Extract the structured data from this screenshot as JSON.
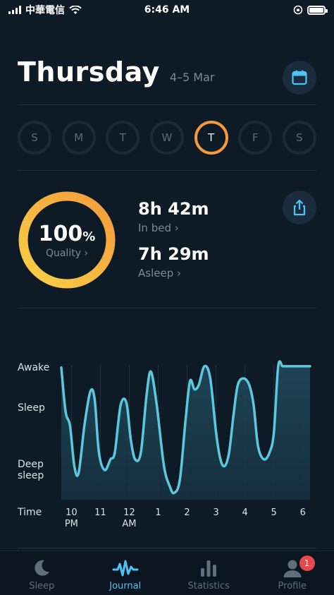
{
  "status_bar": {
    "carrier": "中華電信",
    "time": "6:46 AM"
  },
  "header": {
    "day": "Thursday",
    "date_range": "4–5 Mar"
  },
  "week": [
    {
      "label": "S",
      "active": false
    },
    {
      "label": "M",
      "active": false
    },
    {
      "label": "T",
      "active": false
    },
    {
      "label": "W",
      "active": false
    },
    {
      "label": "T",
      "active": true
    },
    {
      "label": "F",
      "active": false
    },
    {
      "label": "S",
      "active": false
    }
  ],
  "summary": {
    "quality_value": "100",
    "quality_unit": "%",
    "quality_label": "Quality ›",
    "in_bed_value": "8h 42m",
    "in_bed_label": "In bed ›",
    "asleep_value": "7h 29m",
    "asleep_label": "Asleep ›"
  },
  "colors": {
    "accent_orange": "#f49a3c",
    "ring_yellow": "#f7d148",
    "chart_line": "#5cc8dd",
    "tab_active": "#4fc3f7",
    "badge_red": "#e5484d"
  },
  "chart_data": {
    "type": "area",
    "title": "",
    "y_labels": [
      "Awake",
      "Sleep",
      "Deep sleep"
    ],
    "x_label": "Time",
    "x_ticks": [
      "10 PM",
      "11",
      "12 AM",
      "1",
      "2",
      "3",
      "4",
      "5",
      "6"
    ],
    "y_range": [
      0,
      1
    ],
    "note_levels": "1 = Awake, 0.72 = Sleep, 0.2 = Deep sleep",
    "x_hours": [
      21.65,
      21.8,
      21.95,
      22.1,
      22.25,
      22.45,
      22.65,
      22.8,
      22.95,
      23.15,
      23.35,
      23.5,
      23.7,
      23.9,
      24.05,
      24.2,
      24.4,
      24.6,
      24.75,
      24.95,
      25.2,
      25.4,
      25.55,
      25.75,
      25.95,
      26.1,
      26.25,
      26.4,
      26.6,
      26.8,
      27.0,
      27.15,
      27.3,
      27.45,
      27.6,
      27.75,
      27.95,
      28.15,
      28.3,
      28.45,
      28.65,
      28.85,
      29.0,
      29.15,
      29.3,
      29.45,
      29.65,
      29.85,
      30.0,
      30.1,
      30.25
    ],
    "levels": [
      0.98,
      0.65,
      0.55,
      0.25,
      0.2,
      0.55,
      0.8,
      0.75,
      0.35,
      0.22,
      0.3,
      0.35,
      0.7,
      0.72,
      0.45,
      0.3,
      0.35,
      0.78,
      0.95,
      0.7,
      0.25,
      0.1,
      0.05,
      0.15,
      0.6,
      0.88,
      0.82,
      0.85,
      0.99,
      0.9,
      0.5,
      0.3,
      0.25,
      0.35,
      0.62,
      0.85,
      0.9,
      0.85,
      0.7,
      0.4,
      0.3,
      0.35,
      0.5,
      0.99,
      0.99,
      0.99,
      0.99,
      0.99,
      0.99,
      0.99,
      0.99
    ]
  },
  "tabs": [
    {
      "label": "Sleep",
      "active": false
    },
    {
      "label": "Journal",
      "active": true
    },
    {
      "label": "Statistics",
      "active": false
    },
    {
      "label": "Profile",
      "active": false,
      "badge": "1"
    }
  ]
}
